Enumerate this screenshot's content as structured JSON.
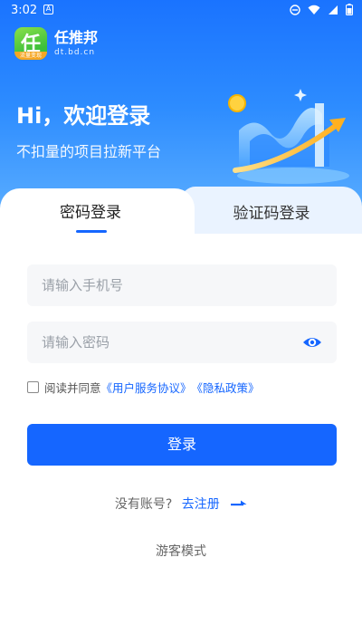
{
  "status_bar": {
    "time": "3:02",
    "notification_letter": "A"
  },
  "brand": {
    "logo_char": "任",
    "logo_strip": "流量变现",
    "name": "任推邦",
    "domain": "dt.bd.cn"
  },
  "hero": {
    "title": "Hi，欢迎登录",
    "subtitle": "不扣量的项目拉新平台"
  },
  "tabs": [
    {
      "label": "密码登录",
      "active": true
    },
    {
      "label": "验证码登录",
      "active": false
    }
  ],
  "form": {
    "phone_placeholder": "请输入手机号",
    "password_placeholder": "请输入密码",
    "agreement_prefix": "阅读并同意",
    "user_agreement_link": "《用户服务协议》",
    "privacy_link": "《隐私政策》",
    "login_label": "登录"
  },
  "register": {
    "question": "没有账号?",
    "link": "去注册"
  },
  "guest": {
    "label": "游客模式"
  },
  "colors": {
    "primary": "#1566ff",
    "hero_top": "#1a73ff",
    "input_bg": "#f6f7f9",
    "inactive_tab_bg": "#eaf3ff"
  },
  "icons": [
    "do-not-disturb-icon",
    "wifi-icon",
    "signal-icon",
    "battery-icon",
    "eye-icon",
    "arrow-right-icon"
  ]
}
